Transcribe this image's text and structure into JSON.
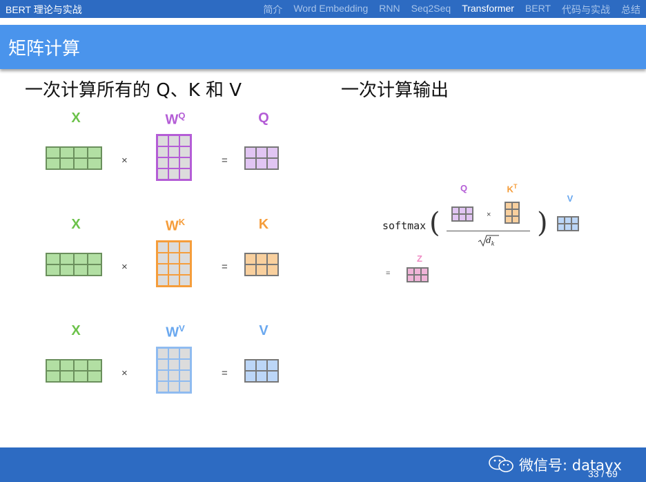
{
  "course_title": "BERT 理论与实战",
  "nav": [
    "简介",
    "Word Embedding",
    "RNN",
    "Seq2Seq",
    "Transformer",
    "BERT",
    "代码与实战",
    "总结"
  ],
  "nav_active": "Transformer",
  "slide_title": "矩阵计算",
  "left_heading": "一次计算所有的 Q、K 和 V",
  "right_heading": "一次计算输出",
  "ops": {
    "times": "×",
    "equals": "="
  },
  "rows": [
    {
      "input": "X",
      "weight": "W",
      "weight_sup": "Q",
      "output": "Q",
      "color": "#b45dd6",
      "fill": "#e1c5f3",
      "border": "#b45dd6"
    },
    {
      "input": "X",
      "weight": "W",
      "weight_sup": "K",
      "output": "K",
      "color": "#f59d3b",
      "fill": "#f9d09e",
      "border": "#f59d3b"
    },
    {
      "input": "X",
      "weight": "W",
      "weight_sup": "V",
      "output": "V",
      "color": "#6aa8ef",
      "fill": "#bcd6f7",
      "border": "#8fbbf0"
    }
  ],
  "input_color": "#6cc24a",
  "input_fill": "#b2dfa3",
  "formula": {
    "softmax": "softmax",
    "q_label": "Q",
    "k_label": "K",
    "k_sup": "T",
    "v_label": "V",
    "z_label": "Z",
    "denominator": "d",
    "denominator_sub": "k",
    "z_color": "#f08bc4",
    "z_fill": "#f0b4d8"
  },
  "footer": {
    "wechat": "微信号: datayx",
    "page": "33 / 69"
  }
}
